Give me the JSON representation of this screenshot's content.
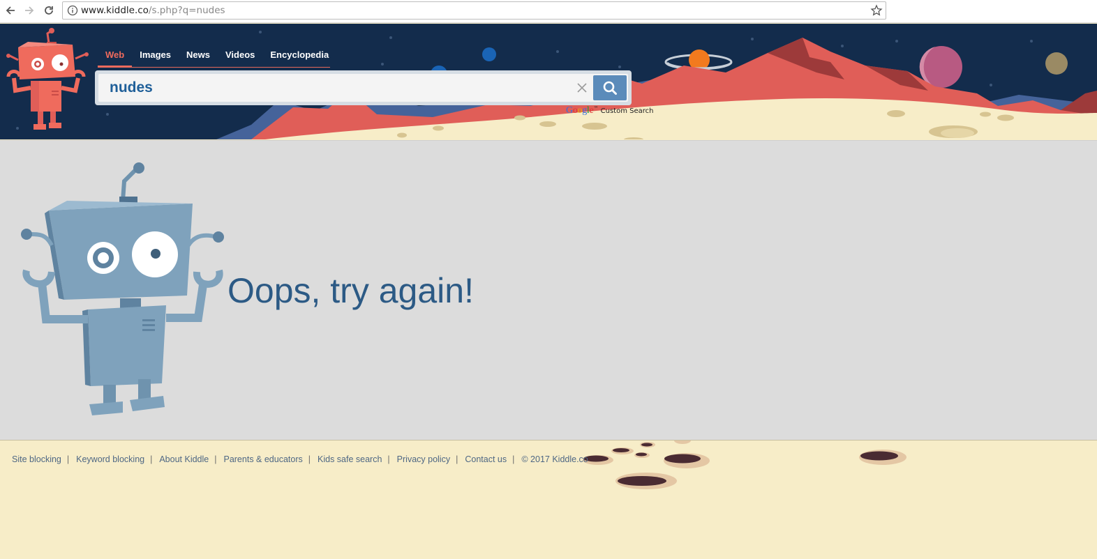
{
  "browser": {
    "url_host": "www.kiddle.co",
    "url_path": "/s.php?q=nudes"
  },
  "header": {
    "tabs": [
      {
        "label": "Web",
        "active": true
      },
      {
        "label": "Images",
        "active": false
      },
      {
        "label": "News",
        "active": false
      },
      {
        "label": "Videos",
        "active": false
      },
      {
        "label": "Encyclopedia",
        "active": false
      }
    ],
    "search": {
      "value": "nudes"
    },
    "google_label": "Google",
    "google_tm": "™",
    "custom_search_label": "Custom Search"
  },
  "main": {
    "message": "Oops, try again!"
  },
  "footer": {
    "links": [
      "Site blocking",
      "Keyword blocking",
      "About Kiddle",
      "Parents & educators",
      "Kids safe search",
      "Privacy policy",
      "Contact us"
    ],
    "copyright": "© 2017 Kiddle.co"
  },
  "colors": {
    "header_bg": "#132c4c",
    "tab_active": "#ef6b5d",
    "search_text": "#1f5f99",
    "search_button": "#5b8bba",
    "message_text": "#2c5a85",
    "main_bg": "#dcdcdc",
    "footer_bg": "#f7edc8",
    "footer_link": "#4e6784"
  },
  "icons": {
    "back": "arrow-left-icon",
    "forward": "arrow-right-icon",
    "reload": "reload-icon",
    "info": "info-icon",
    "bookmark": "star-icon",
    "clear": "close-icon",
    "search": "search-icon"
  }
}
